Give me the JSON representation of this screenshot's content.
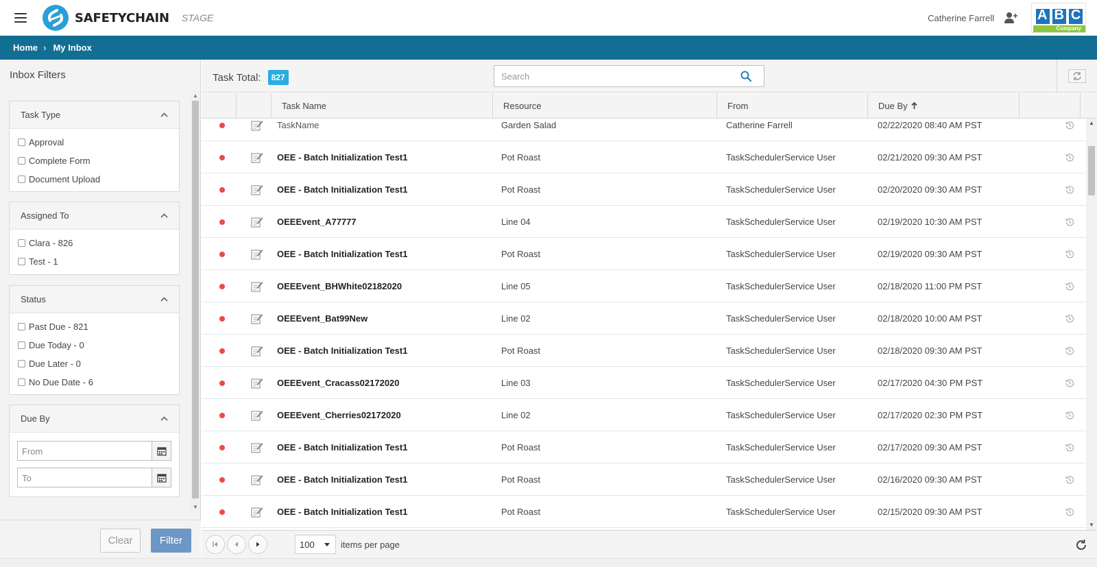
{
  "header": {
    "brand": "SAFETYCHAIN",
    "environment": "STAGE",
    "user_name": "Catherine Farrell",
    "company_logo_text": "ABC",
    "company_logo_sub": "Company"
  },
  "breadcrumb": {
    "items": [
      "Home",
      "My Inbox"
    ]
  },
  "filters": {
    "title": "Inbox Filters",
    "task_type": {
      "title": "Task Type",
      "options": [
        "Approval",
        "Complete Form",
        "Document Upload"
      ]
    },
    "assigned_to": {
      "title": "Assigned To",
      "options": [
        "Clara - 826",
        "Test - 1"
      ]
    },
    "status": {
      "title": "Status",
      "options": [
        "Past Due - 821",
        "Due Today - 0",
        "Due Later - 0",
        "No Due Date - 6"
      ]
    },
    "due_by": {
      "title": "Due By",
      "from_placeholder": "From",
      "to_placeholder": "To"
    },
    "clear_label": "Clear",
    "filter_label": "Filter"
  },
  "toolbar": {
    "task_total_label": "Task Total:",
    "task_total_count": "827",
    "search_placeholder": "Search"
  },
  "grid": {
    "columns": [
      "Task Name",
      "Resource",
      "From",
      "Due By"
    ],
    "sort_column": "Due By",
    "rows": [
      {
        "name": "TaskName",
        "resource": "Garden Salad",
        "from": "Catherine Farrell",
        "due": "02/22/2020 08:40 AM PST",
        "bold": false
      },
      {
        "name": "OEE - Batch Initialization Test1",
        "resource": "Pot Roast",
        "from": "TaskSchedulerService User",
        "due": "02/21/2020 09:30 AM PST",
        "bold": true
      },
      {
        "name": "OEE - Batch Initialization Test1",
        "resource": "Pot Roast",
        "from": "TaskSchedulerService User",
        "due": "02/20/2020 09:30 AM PST",
        "bold": true
      },
      {
        "name": "OEEEvent_A77777",
        "resource": "Line 04",
        "from": "TaskSchedulerService User",
        "due": "02/19/2020 10:30 AM PST",
        "bold": true
      },
      {
        "name": "OEE - Batch Initialization Test1",
        "resource": "Pot Roast",
        "from": "TaskSchedulerService User",
        "due": "02/19/2020 09:30 AM PST",
        "bold": true
      },
      {
        "name": "OEEEvent_BHWhite02182020",
        "resource": "Line 05",
        "from": "TaskSchedulerService User",
        "due": "02/18/2020 11:00 PM PST",
        "bold": true
      },
      {
        "name": "OEEEvent_Bat99New",
        "resource": "Line 02",
        "from": "TaskSchedulerService User",
        "due": "02/18/2020 10:00 AM PST",
        "bold": true
      },
      {
        "name": "OEE - Batch Initialization Test1",
        "resource": "Pot Roast",
        "from": "TaskSchedulerService User",
        "due": "02/18/2020 09:30 AM PST",
        "bold": true
      },
      {
        "name": "OEEEvent_Cracass02172020",
        "resource": "Line 03",
        "from": "TaskSchedulerService User",
        "due": "02/17/2020 04:30 PM PST",
        "bold": true
      },
      {
        "name": "OEEEvent_Cherries02172020",
        "resource": "Line 02",
        "from": "TaskSchedulerService User",
        "due": "02/17/2020 02:30 PM PST",
        "bold": true
      },
      {
        "name": "OEE - Batch Initialization Test1",
        "resource": "Pot Roast",
        "from": "TaskSchedulerService User",
        "due": "02/17/2020 09:30 AM PST",
        "bold": true
      },
      {
        "name": "OEE - Batch Initialization Test1",
        "resource": "Pot Roast",
        "from": "TaskSchedulerService User",
        "due": "02/16/2020 09:30 AM PST",
        "bold": true
      },
      {
        "name": "OEE - Batch Initialization Test1",
        "resource": "Pot Roast",
        "from": "TaskSchedulerService User",
        "due": "02/15/2020 09:30 AM PST",
        "bold": true
      }
    ]
  },
  "pager": {
    "page_size": "100",
    "page_size_label": "items per page"
  },
  "colors": {
    "breadcrumb_bg": "#136e94",
    "badge": "#29aee0",
    "status_dot": "#e94a4a",
    "filter_button": "#6d97c4"
  }
}
